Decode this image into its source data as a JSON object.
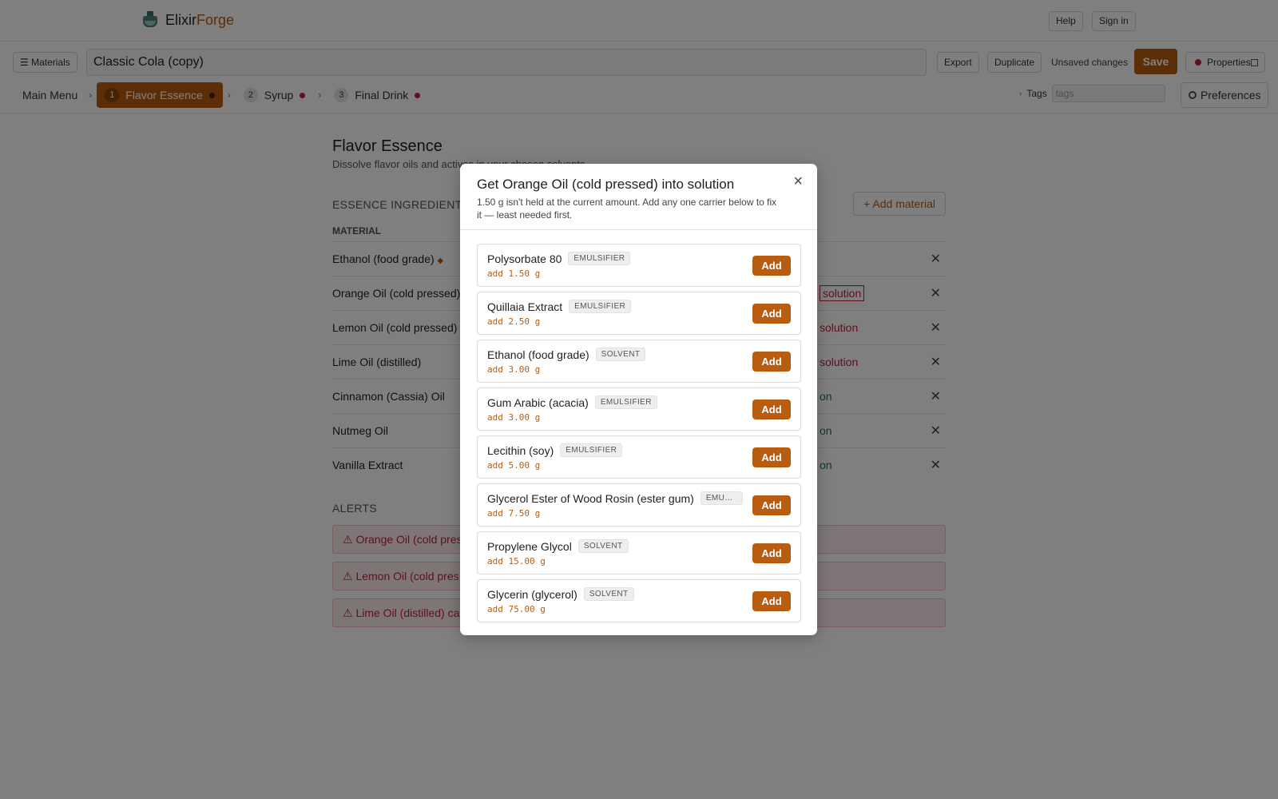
{
  "app": {
    "name_part1": "Elixir",
    "name_part2": "Forge"
  },
  "header": {
    "help": "Help",
    "sign_in": "Sign in"
  },
  "docbar": {
    "materials": "☰ Materials",
    "title": "Classic Cola (copy)",
    "export": "Export",
    "duplicate": "Duplicate",
    "unsaved": "Unsaved changes",
    "save": "Save",
    "properties": "Properties"
  },
  "steps": {
    "main_menu": "Main Menu",
    "items": [
      {
        "num": "1",
        "label": "Flavor Essence"
      },
      {
        "num": "2",
        "label": "Syrup"
      },
      {
        "num": "3",
        "label": "Final Drink"
      }
    ]
  },
  "tags": {
    "label": "Tags",
    "placeholder": "tags"
  },
  "preferences": "Preferences",
  "content": {
    "title": "Flavor Essence",
    "subtitle": "Dissolve flavor oils and actives in your chosen solvents.",
    "section": "ESSENCE INGREDIENTS",
    "add_material": "+ Add material",
    "col_material": "MATERIAL",
    "rows": [
      {
        "name": "Ethanol (food grade)",
        "status": ""
      },
      {
        "name": "Orange Oil (cold pressed)",
        "status": "solution"
      },
      {
        "name": "Lemon Oil (cold pressed)",
        "status": "solution"
      },
      {
        "name": "Lime Oil (distilled)",
        "status": "solution"
      },
      {
        "name": "Cinnamon (Cassia) Oil",
        "status": "on"
      },
      {
        "name": "Nutmeg Oil",
        "status": "on"
      },
      {
        "name": "Vanilla Extract",
        "status": "on"
      }
    ],
    "alerts_h": "ALERTS",
    "alerts": [
      "⚠ Orange Oil (cold pres",
      "⚠ Lemon Oil (cold pres",
      "⚠ Lime Oil (distilled) ca"
    ]
  },
  "modal": {
    "title": "Get Orange Oil (cold pressed) into solution",
    "desc": "1.50 g isn't held at the current amount. Add any one carrier below to fix it — least needed first.",
    "add_label": "Add",
    "options": [
      {
        "name": "Polysorbate 80",
        "type": "EMULSIFIER",
        "amount": "add 1.50 g"
      },
      {
        "name": "Quillaia Extract",
        "type": "EMULSIFIER",
        "amount": "add 2.50 g"
      },
      {
        "name": "Ethanol (food grade)",
        "type": "SOLVENT",
        "amount": "add 3.00 g"
      },
      {
        "name": "Gum Arabic (acacia)",
        "type": "EMULSIFIER",
        "amount": "add 3.00 g"
      },
      {
        "name": "Lecithin (soy)",
        "type": "EMULSIFIER",
        "amount": "add 5.00 g"
      },
      {
        "name": "Glycerol Ester of Wood Rosin (ester gum)",
        "type": "EMULSIFIER",
        "amount": "add 7.50 g"
      },
      {
        "name": "Propylene Glycol",
        "type": "SOLVENT",
        "amount": "add 15.00 g"
      },
      {
        "name": "Glycerin (glycerol)",
        "type": "SOLVENT",
        "amount": "add 75.00 g"
      }
    ]
  },
  "colors": {
    "accent": "#b85c10",
    "error": "#c51d3a",
    "ok": "#1f7a4d"
  }
}
